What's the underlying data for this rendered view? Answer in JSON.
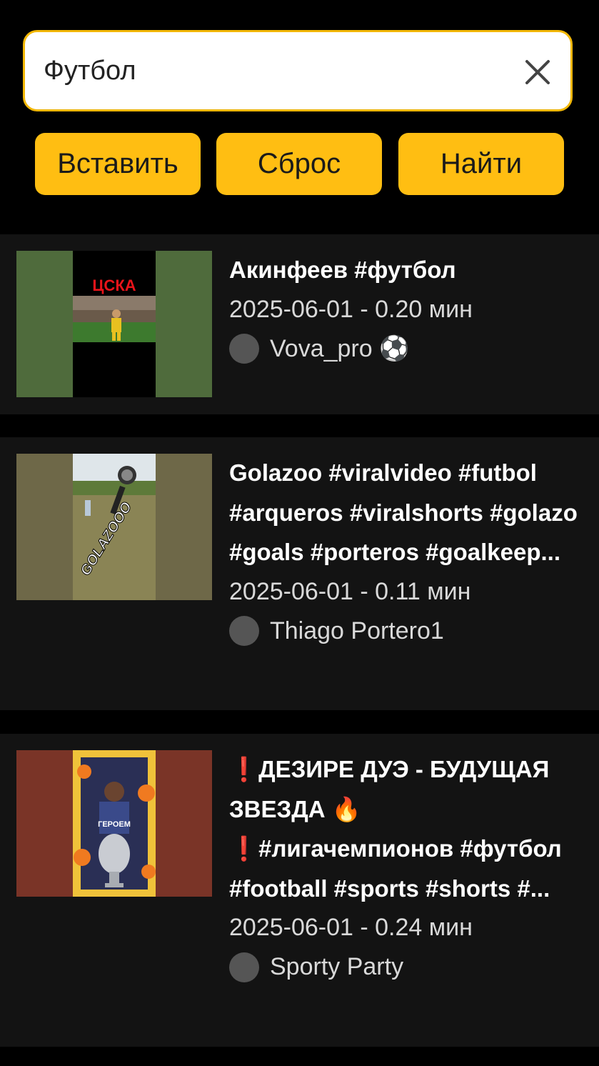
{
  "search": {
    "value": "Футбол",
    "placeholder": ""
  },
  "buttons": {
    "paste_label": "Вставить",
    "reset_label": "Сброс",
    "find_label": "Найти"
  },
  "colors": {
    "accent": "#ffbe12",
    "background": "#000000",
    "card_background": "#131313"
  },
  "results": [
    {
      "title": "Акинфеев #футбол",
      "meta": "2025-06-01 - 0.20 мин",
      "author": "Vova_pro ⚽",
      "thumb_caption": "ЦСКА",
      "thumb_icon": "goalkeeper-photo"
    },
    {
      "title": "Golazoo #viralvideo #futbol #arqueros #viralshorts #golazo #goals #porteros #goalkeep...",
      "meta": "2025-06-01 - 0.11 мин",
      "author": "Thiago Portero1",
      "thumb_caption": "GOLAZOOO",
      "thumb_icon": "keeper-save-photo"
    },
    {
      "title": "❗ДЕЗИРЕ ДУЭ - БУДУЩАЯ ЗВЕЗДА 🔥 ❗#лигачемпионов #футбол #football #sports #shorts #...",
      "meta": "2025-06-01 - 0.24 мин",
      "author": "Sporty Party",
      "thumb_caption": "ГЕРОЕМ",
      "thumb_icon": "trophy-photo"
    }
  ]
}
